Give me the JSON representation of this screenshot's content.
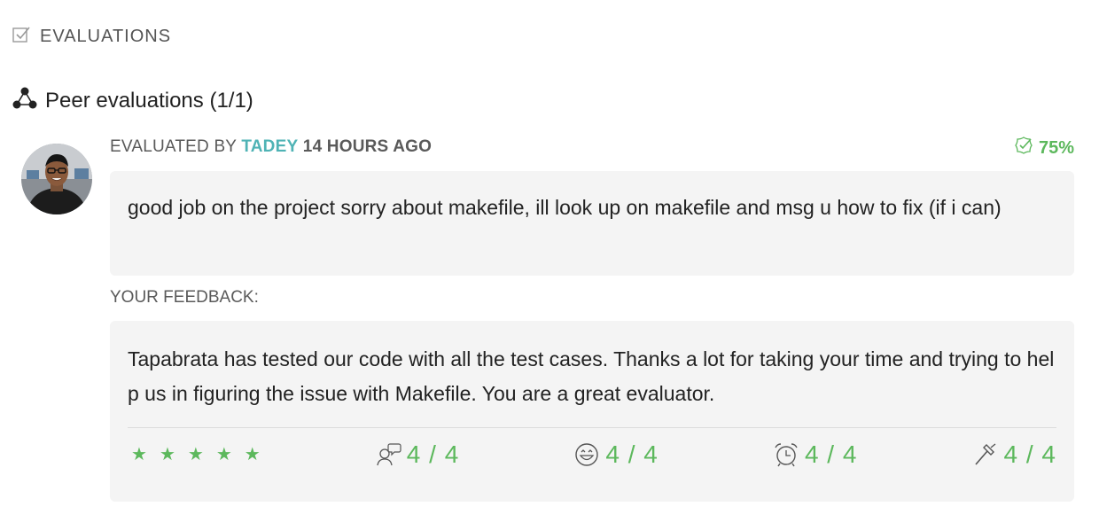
{
  "section": {
    "title": "EVALUATIONS",
    "icon": "checkbox-icon"
  },
  "peer": {
    "title": "Peer evaluations (1/1)",
    "icon": "network-icon"
  },
  "evaluation": {
    "evaluated_by_prefix": "EVALUATED BY",
    "evaluator_login": "TADEY",
    "time_ago": "14 HOURS AGO",
    "grade": "75%",
    "comment": "good job on the project sorry about makefile, ill look up on makefile and msg u how to fix (if i can)"
  },
  "feedback": {
    "label": "YOUR FEEDBACK:",
    "text": "Tapabrata has tested our code with all the test cases. Thanks a lot for taking your time and trying to help us in figuring the issue with Makefile. You are a great evaluator.",
    "rating_stars": 5,
    "rating_max": 5,
    "metrics": [
      {
        "icon": "talk-icon",
        "score": "4 / 4"
      },
      {
        "icon": "smile-icon",
        "score": "4 / 4"
      },
      {
        "icon": "alarm-clock-icon",
        "score": "4 / 4"
      },
      {
        "icon": "hammer-icon",
        "score": "4 / 4"
      }
    ]
  },
  "colors": {
    "accent_green": "#5cb85c",
    "login_teal": "#4fb3b5",
    "box_bg": "#f4f4f4"
  }
}
